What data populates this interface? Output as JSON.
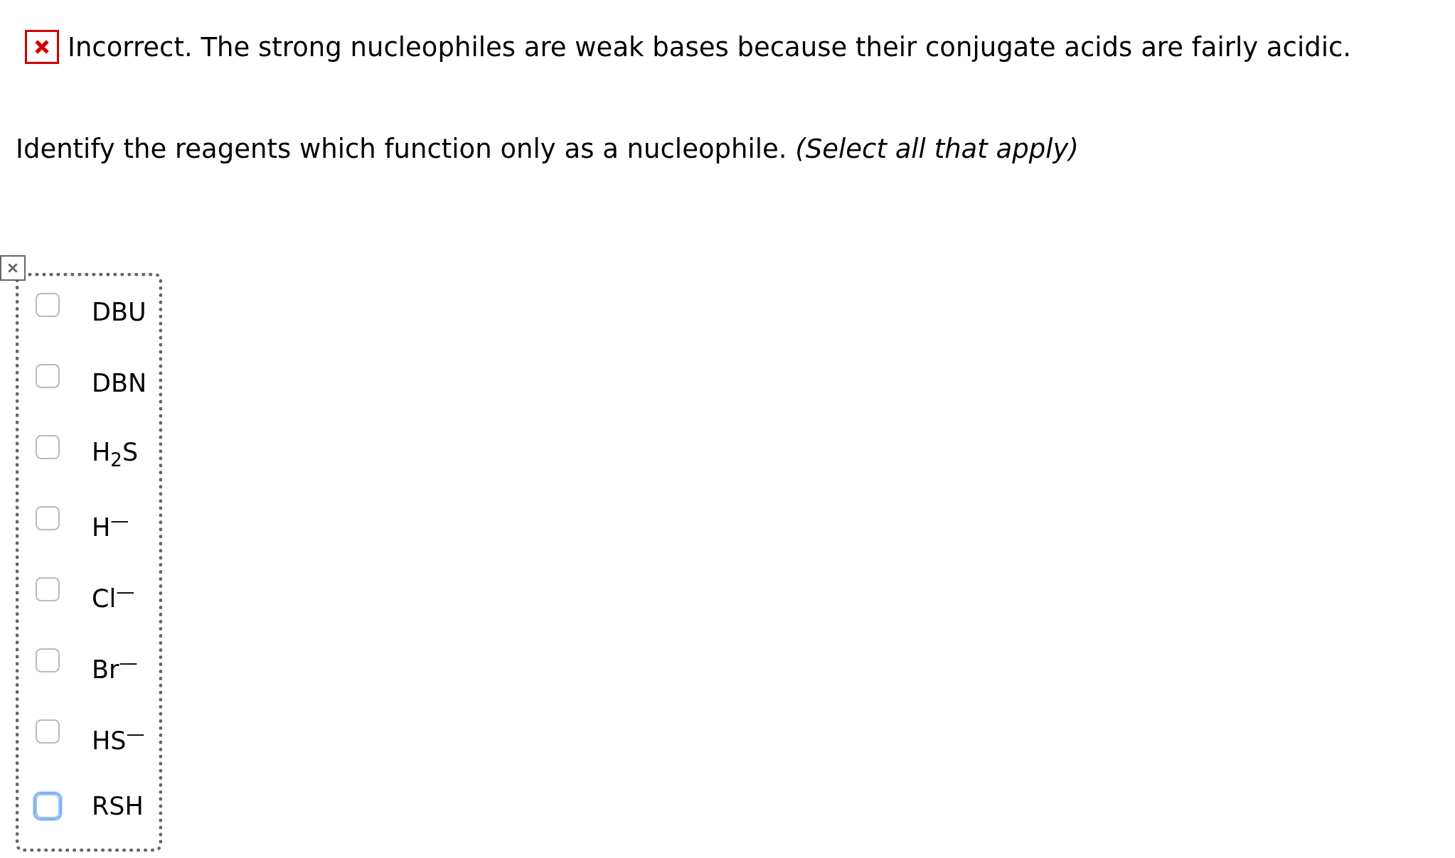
{
  "feedback": {
    "kind": "incorrect",
    "text": "Incorrect. The strong nucleophiles are weak bases because their conjugate acids are fairly acidic."
  },
  "question": {
    "text": "Identify the reagents which function only as a nucleophile. *(Select all that apply)*"
  },
  "options": [
    {
      "label": "DBU",
      "checked": false,
      "focused": false
    },
    {
      "label": "DBN",
      "checked": false,
      "focused": false
    },
    {
      "label": "H$_{2}$S",
      "checked": false,
      "focused": false
    },
    {
      "label": "H$^{—}$",
      "checked": false,
      "focused": false
    },
    {
      "label": "Cl$^{—}$",
      "checked": false,
      "focused": false
    },
    {
      "label": "Br$^{—}$",
      "checked": false,
      "focused": false
    },
    {
      "label": "HS$^{—}$",
      "checked": false,
      "focused": false
    },
    {
      "label": "RSH",
      "checked": false,
      "focused": true
    }
  ]
}
